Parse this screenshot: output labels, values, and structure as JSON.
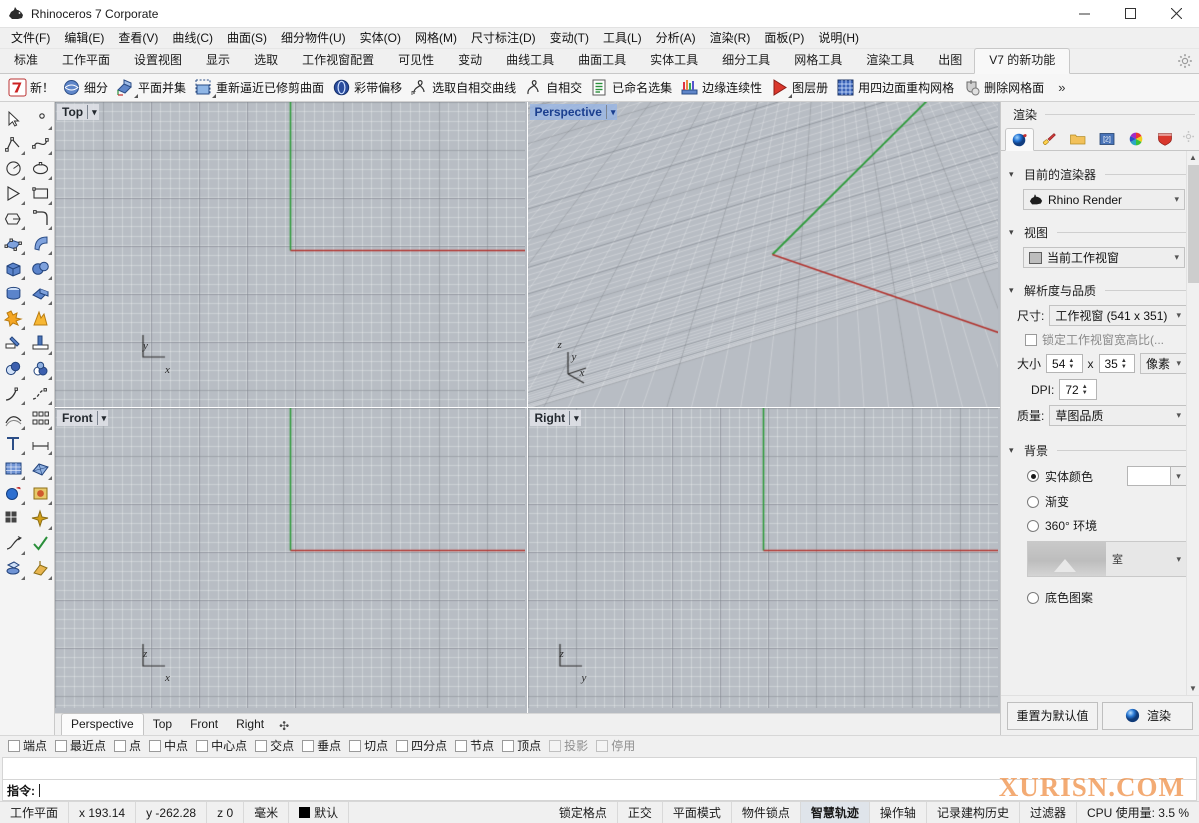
{
  "window": {
    "title": "Rhinoceros 7 Corporate",
    "minimize": "─",
    "maximize": "☐",
    "close": "✕"
  },
  "menubar": {
    "items": [
      {
        "label": "文件(F)"
      },
      {
        "label": "编辑(E)"
      },
      {
        "label": "查看(V)"
      },
      {
        "label": "曲线(C)"
      },
      {
        "label": "曲面(S)"
      },
      {
        "label": "细分物件(U)"
      },
      {
        "label": "实体(O)"
      },
      {
        "label": "网格(M)"
      },
      {
        "label": "尺寸标注(D)"
      },
      {
        "label": "变动(T)"
      },
      {
        "label": "工具(L)"
      },
      {
        "label": "分析(A)"
      },
      {
        "label": "渲染(R)"
      },
      {
        "label": "面板(P)"
      },
      {
        "label": "说明(H)"
      }
    ]
  },
  "tabstrip": {
    "tabs": [
      {
        "label": "标准",
        "active": false
      },
      {
        "label": "工作平面",
        "active": false
      },
      {
        "label": "设置视图",
        "active": false
      },
      {
        "label": "显示",
        "active": false
      },
      {
        "label": "选取",
        "active": false
      },
      {
        "label": "工作视窗配置",
        "active": false
      },
      {
        "label": "可见性",
        "active": false
      },
      {
        "label": "变动",
        "active": false
      },
      {
        "label": "曲线工具",
        "active": false
      },
      {
        "label": "曲面工具",
        "active": false
      },
      {
        "label": "实体工具",
        "active": false
      },
      {
        "label": "细分工具",
        "active": false
      },
      {
        "label": "网格工具",
        "active": false
      },
      {
        "label": "渲染工具",
        "active": false
      },
      {
        "label": "出图",
        "active": false
      },
      {
        "label": "V7 的新功能",
        "active": true
      }
    ],
    "settings_icon": "gear-icon"
  },
  "icontoolbar": {
    "items": [
      {
        "label": "新！",
        "icon": "rhino-new-icon",
        "dropdown": false
      },
      {
        "label": "细分",
        "icon": "subd-icon",
        "dropdown": false
      },
      {
        "label": "平面并集",
        "icon": "planar-union-icon",
        "dropdown": true
      },
      {
        "label": "重新逼近已修剪曲面",
        "icon": "refit-trimmed-surface-icon",
        "dropdown": true
      },
      {
        "label": "彩带偏移",
        "icon": "ribbon-offset-icon",
        "dropdown": false
      },
      {
        "label": "选取自相交曲线",
        "icon": "select-self-intersecting-curve-icon",
        "dropdown": false
      },
      {
        "label": "自相交",
        "icon": "self-intersect-icon",
        "dropdown": false
      },
      {
        "label": "已命名选集",
        "icon": "named-selection-icon",
        "dropdown": false
      },
      {
        "label": "边缘连续性",
        "icon": "edge-continuity-icon",
        "dropdown": false
      },
      {
        "label": "图层册",
        "icon": "layer-book-icon",
        "dropdown": true
      },
      {
        "label": "用四边面重构网格",
        "icon": "quad-remesh-icon",
        "dropdown": false
      },
      {
        "label": "删除网格面",
        "icon": "delete-mesh-face-icon",
        "dropdown": false
      }
    ],
    "overflow": "»"
  },
  "leftbar": {
    "rows": [
      [
        {
          "icon": "select-arrow-icon",
          "dropdown": false
        },
        {
          "icon": "point-icon",
          "dropdown": true
        }
      ],
      [
        {
          "icon": "polyline-icon",
          "dropdown": true
        },
        {
          "icon": "control-point-curve-icon",
          "dropdown": true
        }
      ],
      [
        {
          "icon": "circle-icon",
          "dropdown": true
        },
        {
          "icon": "ellipse-icon",
          "dropdown": true
        }
      ],
      [
        {
          "icon": "arc-icon",
          "dropdown": true
        },
        {
          "icon": "rectangle-icon",
          "dropdown": true
        }
      ],
      [
        {
          "icon": "polygon-icon",
          "dropdown": true
        },
        {
          "icon": "curve-fillet-icon",
          "dropdown": true
        }
      ],
      [
        {
          "icon": "surface-from-points-icon",
          "dropdown": true
        },
        {
          "icon": "loft-surface-icon",
          "dropdown": true
        }
      ],
      [
        {
          "icon": "box-solid-icon",
          "dropdown": true
        },
        {
          "icon": "sphere-solid-icon",
          "dropdown": true
        }
      ],
      [
        {
          "icon": "cylinder-solid-icon",
          "dropdown": true
        },
        {
          "icon": "solid-edit-icon",
          "dropdown": true
        }
      ],
      [
        {
          "icon": "explode-icon",
          "dropdown": true
        },
        {
          "icon": "boolean-split-icon",
          "dropdown": false
        }
      ],
      [
        {
          "icon": "trim-icon",
          "dropdown": true
        },
        {
          "icon": "split-icon",
          "dropdown": true
        }
      ],
      [
        {
          "icon": "boolean-union-icon",
          "dropdown": true
        },
        {
          "icon": "boolean-difference-icon",
          "dropdown": true
        }
      ],
      [
        {
          "icon": "fillet-curve-icon",
          "dropdown": true
        },
        {
          "icon": "blend-curve-icon",
          "dropdown": true
        }
      ],
      [
        {
          "icon": "offset-curve-icon",
          "dropdown": true
        },
        {
          "icon": "array-icon",
          "dropdown": true
        }
      ],
      [
        {
          "icon": "text-object-icon",
          "dropdown": true
        },
        {
          "icon": "dimension-icon",
          "dropdown": true
        }
      ],
      [
        {
          "icon": "mesh-from-surface-icon",
          "dropdown": true
        },
        {
          "icon": "mesh-edit-icon",
          "dropdown": true
        }
      ],
      [
        {
          "icon": "render-icon",
          "dropdown": true
        },
        {
          "icon": "material-icon",
          "dropdown": true
        }
      ],
      [
        {
          "icon": "grid-snap-icon",
          "dropdown": false
        },
        {
          "icon": "analyze-icon",
          "dropdown": true
        }
      ],
      [
        {
          "icon": "transform-icon",
          "dropdown": true
        },
        {
          "icon": "check-icon",
          "dropdown": false
        }
      ],
      [
        {
          "icon": "print-icon",
          "dropdown": true
        },
        {
          "icon": "export-icon",
          "dropdown": true
        }
      ]
    ]
  },
  "viewports": [
    {
      "name": "Top",
      "active": false,
      "axes": [
        "y",
        "x"
      ],
      "projection": "ortho-top"
    },
    {
      "name": "Perspective",
      "active": true,
      "axes": [
        "z",
        "y",
        "x"
      ],
      "projection": "perspective"
    },
    {
      "name": "Front",
      "active": false,
      "axes": [
        "z",
        "x"
      ],
      "projection": "ortho-front"
    },
    {
      "name": "Right",
      "active": false,
      "axes": [
        "z",
        "y"
      ],
      "projection": "ortho-right"
    }
  ],
  "viewport_tabs": {
    "tabs": [
      {
        "label": "Perspective",
        "active": true
      },
      {
        "label": "Top",
        "active": false
      },
      {
        "label": "Front",
        "active": false
      },
      {
        "label": "Right",
        "active": false
      }
    ],
    "add": "✣"
  },
  "rightpanel": {
    "header": "渲染",
    "tabs": [
      {
        "icon": "render-globe-icon",
        "active": true
      },
      {
        "icon": "material-brush-icon",
        "active": false
      },
      {
        "icon": "folder-icon",
        "active": false
      },
      {
        "icon": "texture-icon",
        "active": false
      },
      {
        "icon": "color-wheel-icon",
        "active": false
      },
      {
        "icon": "environment-shield-icon",
        "active": false
      }
    ],
    "settings_icon": "gear-icon",
    "sections": {
      "current_renderer": {
        "title": "目前的渲染器",
        "value": "Rhino Render",
        "icon": "rhino-head-icon"
      },
      "view": {
        "title": "视图",
        "value": "当前工作视窗",
        "icon": "viewport-icon"
      },
      "resolution_quality": {
        "title": "解析度与品质",
        "size_label": "尺寸:",
        "size_value": "工作视窗 (541 x 351)",
        "lock_aspect_label": "锁定工作视窗宽高比(...",
        "lock_aspect_checked": false,
        "dimension_label": "大小",
        "width_value": "54",
        "times": "x",
        "height_value": "35",
        "unit_value": "像素",
        "dpi_label": "DPI:",
        "dpi_value": "72",
        "quality_label": "质量:",
        "quality_value": "草图品质"
      },
      "background": {
        "title": "背景",
        "options": [
          {
            "label": "实体颜色",
            "selected": true
          },
          {
            "label": "渐变",
            "selected": false
          },
          {
            "label": "360° 环境",
            "selected": false
          },
          {
            "label": "底色图案",
            "selected": false
          }
        ],
        "solid_color": "#ffffff",
        "environment_name": "室"
      }
    },
    "footer": {
      "reset_label": "重置为默认值",
      "render_label": "渲染",
      "render_icon": "render-sphere-icon"
    }
  },
  "osnapbar": {
    "items": [
      {
        "label": "端点",
        "checked": false,
        "disabled": false
      },
      {
        "label": "最近点",
        "checked": false,
        "disabled": false
      },
      {
        "label": "点",
        "checked": false,
        "disabled": false
      },
      {
        "label": "中点",
        "checked": false,
        "disabled": false
      },
      {
        "label": "中心点",
        "checked": false,
        "disabled": false
      },
      {
        "label": "交点",
        "checked": false,
        "disabled": false
      },
      {
        "label": "垂点",
        "checked": false,
        "disabled": false
      },
      {
        "label": "切点",
        "checked": false,
        "disabled": false
      },
      {
        "label": "四分点",
        "checked": false,
        "disabled": false
      },
      {
        "label": "节点",
        "checked": false,
        "disabled": false
      },
      {
        "label": "顶点",
        "checked": false,
        "disabled": false
      },
      {
        "label": "投影",
        "checked": false,
        "disabled": true
      },
      {
        "label": "停用",
        "checked": false,
        "disabled": true
      }
    ]
  },
  "commandline": {
    "label": "指令:",
    "value": "",
    "placeholder": ""
  },
  "statusbar": {
    "cplane": "工作平面",
    "x": "x 193.14",
    "y": "y -262.28",
    "z": "z 0",
    "units": "毫米",
    "layer": "默认",
    "layer_color": "#000000",
    "toggles": [
      {
        "label": "锁定格点",
        "active": false
      },
      {
        "label": "正交",
        "active": false
      },
      {
        "label": "平面模式",
        "active": false
      },
      {
        "label": "物件锁点",
        "active": false
      },
      {
        "label": "智慧轨迹",
        "active": true
      },
      {
        "label": "操作轴",
        "active": false
      },
      {
        "label": "记录建构历史",
        "active": false
      },
      {
        "label": "过滤器",
        "active": false
      }
    ],
    "cpu": "CPU 使用量: 3.5 %"
  },
  "watermark": "XURISN.COM"
}
